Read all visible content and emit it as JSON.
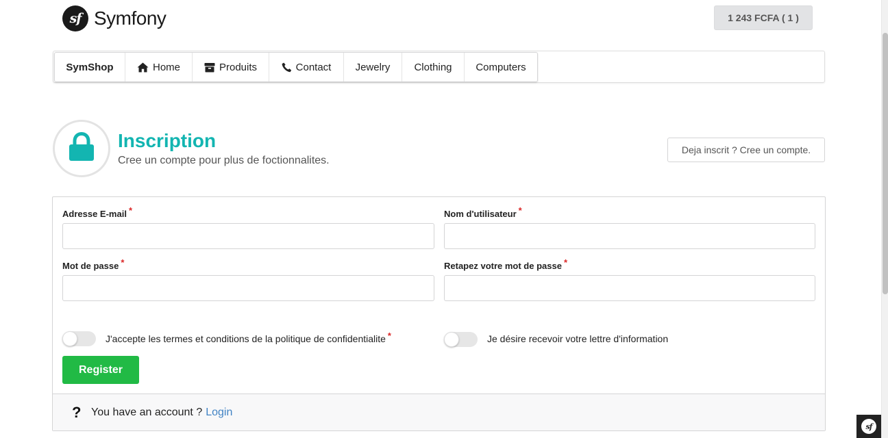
{
  "header": {
    "logo_mark": "sf",
    "logo_text": "Symfony",
    "cart_label": "1 243 FCFA ( 1 )"
  },
  "nav": {
    "brand": "SymShop",
    "items": [
      {
        "label": "Home",
        "icon": "home-icon"
      },
      {
        "label": "Produits",
        "icon": "box-icon"
      },
      {
        "label": "Contact",
        "icon": "phone-icon"
      },
      {
        "label": "Jewelry"
      },
      {
        "label": "Clothing"
      },
      {
        "label": "Computers"
      }
    ]
  },
  "page": {
    "icon": "lock-icon",
    "title": "Inscription",
    "subtitle": "Cree un compte pour plus de foctionnalites.",
    "already_button": "Deja inscrit ? Cree un compte."
  },
  "form": {
    "required_mark": "*",
    "email_label": "Adresse E-mail",
    "email_value": "",
    "username_label": "Nom d'utilisateur",
    "username_value": "",
    "password_label": "Mot de passe",
    "password_value": "",
    "password_confirm_label": "Retapez votre mot de passe",
    "password_confirm_value": "",
    "terms_label": "J'accepte les termes et conditions de la politique de confidentialite",
    "terms_checked": false,
    "newsletter_label": "Je désire recevoir votre lettre d'information",
    "newsletter_checked": false,
    "submit_label": "Register"
  },
  "footer": {
    "question_mark": "?",
    "text": "You have an account ?",
    "link": "Login"
  },
  "colors": {
    "accent": "#13b5b1",
    "register": "#21ba45",
    "link": "#4183c4",
    "required": "#db2828"
  },
  "toolbar_badge": "sf"
}
